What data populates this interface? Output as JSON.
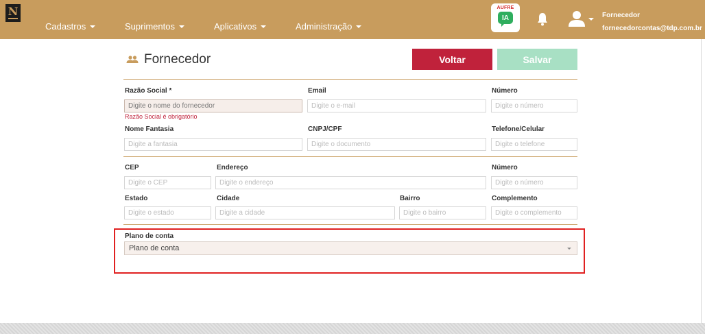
{
  "brand": {
    "logo_text": "N"
  },
  "nav": {
    "items": [
      {
        "label": "Cadastros"
      },
      {
        "label": "Suprimentos"
      },
      {
        "label": "Aplicativos"
      },
      {
        "label": "Administração"
      }
    ]
  },
  "aufre": {
    "top_text": "AUFRE",
    "badge": "IA"
  },
  "user": {
    "name": "Fornecedor",
    "email": "fornecedorcontas@tdp.com.br"
  },
  "page": {
    "title": "Fornecedor"
  },
  "actions": {
    "back_label": "Voltar",
    "save_label": "Salvar"
  },
  "form": {
    "razao_social": {
      "label": "Razão Social *",
      "placeholder": "Digite o nome do fornecedor",
      "error": "Razão Social é obrigatório"
    },
    "email": {
      "label": "Email",
      "placeholder": "Digite o e-mail"
    },
    "numero1": {
      "label": "Número",
      "placeholder": "Digite o número"
    },
    "nome_fantasia": {
      "label": "Nome Fantasia",
      "placeholder": "Digite a fantasia"
    },
    "cnpj_cpf": {
      "label": "CNPJ/CPF",
      "placeholder": "Digite o documento"
    },
    "telefone": {
      "label": "Telefone/Celular",
      "placeholder": "Digite o telefone"
    },
    "cep": {
      "label": "CEP",
      "placeholder": "Digite o CEP"
    },
    "endereco": {
      "label": "Endereço",
      "placeholder": "Digite o endereço"
    },
    "numero2": {
      "label": "Número",
      "placeholder": "Digite o número"
    },
    "estado": {
      "label": "Estado",
      "placeholder": "Digite o estado"
    },
    "cidade": {
      "label": "Cidade",
      "placeholder": "Digite a cidade"
    },
    "bairro": {
      "label": "Bairro",
      "placeholder": "Digite o bairro"
    },
    "complemento": {
      "label": "Complemento",
      "placeholder": "Digite o complemento"
    },
    "plano_de_conta": {
      "label": "Plano de conta",
      "selected": "Plano de conta"
    }
  },
  "colors": {
    "navbar": "#c89c5d",
    "voltar": "#c0223b",
    "salvar": "#a8e0c4",
    "highlight": "#e02020"
  }
}
